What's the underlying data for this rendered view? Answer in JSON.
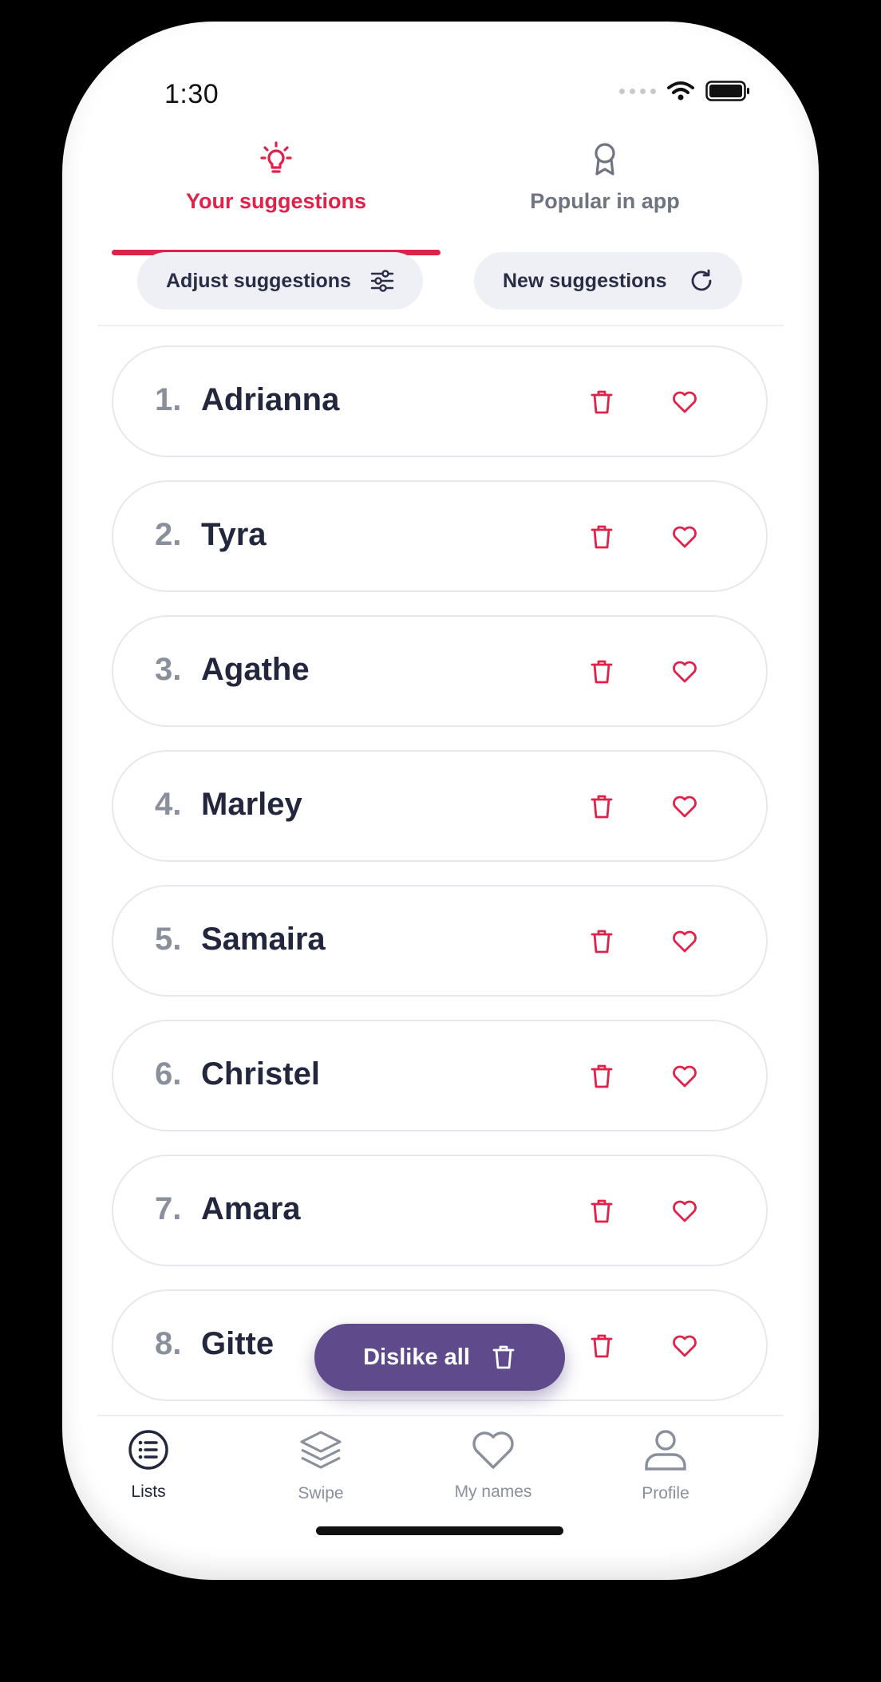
{
  "status_bar": {
    "time": "1:30"
  },
  "tabs": [
    {
      "label": "Your suggestions",
      "icon": "lightbulb-icon",
      "active": true
    },
    {
      "label": "Popular in app",
      "icon": "award-icon",
      "active": false
    }
  ],
  "actions": {
    "adjust_label": "Adjust suggestions",
    "new_label": "New suggestions"
  },
  "names": [
    {
      "index": "1.",
      "name": "Adrianna"
    },
    {
      "index": "2.",
      "name": "Tyra"
    },
    {
      "index": "3.",
      "name": "Agathe"
    },
    {
      "index": "4.",
      "name": "Marley"
    },
    {
      "index": "5.",
      "name": "Samaira"
    },
    {
      "index": "6.",
      "name": "Christel"
    },
    {
      "index": "7.",
      "name": "Amara"
    },
    {
      "index": "8.",
      "name": "Gitte"
    }
  ],
  "fab": {
    "label": "Dislike all"
  },
  "bottom_nav": [
    {
      "label": "Lists",
      "icon": "list-icon",
      "active": true
    },
    {
      "label": "Swipe",
      "icon": "layers-icon",
      "active": false
    },
    {
      "label": "My names",
      "icon": "heart-icon",
      "active": false
    },
    {
      "label": "Profile",
      "icon": "user-icon",
      "active": false
    }
  ],
  "colors": {
    "accent": "#e0224a",
    "fab": "#5f4b8b",
    "text_dark": "#22273e",
    "text_muted": "#8a8f9c"
  }
}
